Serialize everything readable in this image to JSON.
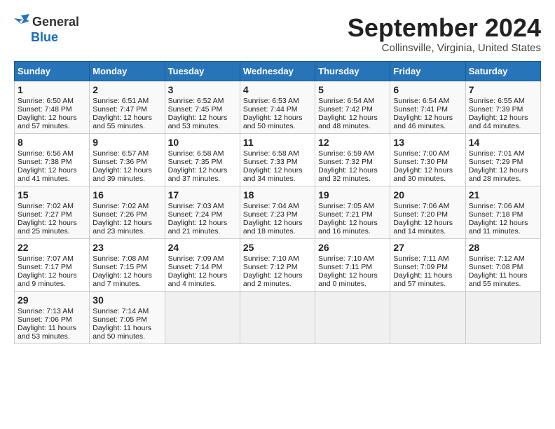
{
  "header": {
    "logo_line1": "General",
    "logo_line2": "Blue",
    "title": "September 2024",
    "subtitle": "Collinsville, Virginia, United States"
  },
  "columns": [
    "Sunday",
    "Monday",
    "Tuesday",
    "Wednesday",
    "Thursday",
    "Friday",
    "Saturday"
  ],
  "weeks": [
    [
      {
        "day": "1",
        "lines": [
          "Sunrise: 6:50 AM",
          "Sunset: 7:48 PM",
          "Daylight: 12 hours",
          "and 57 minutes."
        ]
      },
      {
        "day": "2",
        "lines": [
          "Sunrise: 6:51 AM",
          "Sunset: 7:47 PM",
          "Daylight: 12 hours",
          "and 55 minutes."
        ]
      },
      {
        "day": "3",
        "lines": [
          "Sunrise: 6:52 AM",
          "Sunset: 7:45 PM",
          "Daylight: 12 hours",
          "and 53 minutes."
        ]
      },
      {
        "day": "4",
        "lines": [
          "Sunrise: 6:53 AM",
          "Sunset: 7:44 PM",
          "Daylight: 12 hours",
          "and 50 minutes."
        ]
      },
      {
        "day": "5",
        "lines": [
          "Sunrise: 6:54 AM",
          "Sunset: 7:42 PM",
          "Daylight: 12 hours",
          "and 48 minutes."
        ]
      },
      {
        "day": "6",
        "lines": [
          "Sunrise: 6:54 AM",
          "Sunset: 7:41 PM",
          "Daylight: 12 hours",
          "and 46 minutes."
        ]
      },
      {
        "day": "7",
        "lines": [
          "Sunrise: 6:55 AM",
          "Sunset: 7:39 PM",
          "Daylight: 12 hours",
          "and 44 minutes."
        ]
      }
    ],
    [
      {
        "day": "8",
        "lines": [
          "Sunrise: 6:56 AM",
          "Sunset: 7:38 PM",
          "Daylight: 12 hours",
          "and 41 minutes."
        ]
      },
      {
        "day": "9",
        "lines": [
          "Sunrise: 6:57 AM",
          "Sunset: 7:36 PM",
          "Daylight: 12 hours",
          "and 39 minutes."
        ]
      },
      {
        "day": "10",
        "lines": [
          "Sunrise: 6:58 AM",
          "Sunset: 7:35 PM",
          "Daylight: 12 hours",
          "and 37 minutes."
        ]
      },
      {
        "day": "11",
        "lines": [
          "Sunrise: 6:58 AM",
          "Sunset: 7:33 PM",
          "Daylight: 12 hours",
          "and 34 minutes."
        ]
      },
      {
        "day": "12",
        "lines": [
          "Sunrise: 6:59 AM",
          "Sunset: 7:32 PM",
          "Daylight: 12 hours",
          "and 32 minutes."
        ]
      },
      {
        "day": "13",
        "lines": [
          "Sunrise: 7:00 AM",
          "Sunset: 7:30 PM",
          "Daylight: 12 hours",
          "and 30 minutes."
        ]
      },
      {
        "day": "14",
        "lines": [
          "Sunrise: 7:01 AM",
          "Sunset: 7:29 PM",
          "Daylight: 12 hours",
          "and 28 minutes."
        ]
      }
    ],
    [
      {
        "day": "15",
        "lines": [
          "Sunrise: 7:02 AM",
          "Sunset: 7:27 PM",
          "Daylight: 12 hours",
          "and 25 minutes."
        ]
      },
      {
        "day": "16",
        "lines": [
          "Sunrise: 7:02 AM",
          "Sunset: 7:26 PM",
          "Daylight: 12 hours",
          "and 23 minutes."
        ]
      },
      {
        "day": "17",
        "lines": [
          "Sunrise: 7:03 AM",
          "Sunset: 7:24 PM",
          "Daylight: 12 hours",
          "and 21 minutes."
        ]
      },
      {
        "day": "18",
        "lines": [
          "Sunrise: 7:04 AM",
          "Sunset: 7:23 PM",
          "Daylight: 12 hours",
          "and 18 minutes."
        ]
      },
      {
        "day": "19",
        "lines": [
          "Sunrise: 7:05 AM",
          "Sunset: 7:21 PM",
          "Daylight: 12 hours",
          "and 16 minutes."
        ]
      },
      {
        "day": "20",
        "lines": [
          "Sunrise: 7:06 AM",
          "Sunset: 7:20 PM",
          "Daylight: 12 hours",
          "and 14 minutes."
        ]
      },
      {
        "day": "21",
        "lines": [
          "Sunrise: 7:06 AM",
          "Sunset: 7:18 PM",
          "Daylight: 12 hours",
          "and 11 minutes."
        ]
      }
    ],
    [
      {
        "day": "22",
        "lines": [
          "Sunrise: 7:07 AM",
          "Sunset: 7:17 PM",
          "Daylight: 12 hours",
          "and 9 minutes."
        ]
      },
      {
        "day": "23",
        "lines": [
          "Sunrise: 7:08 AM",
          "Sunset: 7:15 PM",
          "Daylight: 12 hours",
          "and 7 minutes."
        ]
      },
      {
        "day": "24",
        "lines": [
          "Sunrise: 7:09 AM",
          "Sunset: 7:14 PM",
          "Daylight: 12 hours",
          "and 4 minutes."
        ]
      },
      {
        "day": "25",
        "lines": [
          "Sunrise: 7:10 AM",
          "Sunset: 7:12 PM",
          "Daylight: 12 hours",
          "and 2 minutes."
        ]
      },
      {
        "day": "26",
        "lines": [
          "Sunrise: 7:10 AM",
          "Sunset: 7:11 PM",
          "Daylight: 12 hours",
          "and 0 minutes."
        ]
      },
      {
        "day": "27",
        "lines": [
          "Sunrise: 7:11 AM",
          "Sunset: 7:09 PM",
          "Daylight: 11 hours",
          "and 57 minutes."
        ]
      },
      {
        "day": "28",
        "lines": [
          "Sunrise: 7:12 AM",
          "Sunset: 7:08 PM",
          "Daylight: 11 hours",
          "and 55 minutes."
        ]
      }
    ],
    [
      {
        "day": "29",
        "lines": [
          "Sunrise: 7:13 AM",
          "Sunset: 7:06 PM",
          "Daylight: 11 hours",
          "and 53 minutes."
        ]
      },
      {
        "day": "30",
        "lines": [
          "Sunrise: 7:14 AM",
          "Sunset: 7:05 PM",
          "Daylight: 11 hours",
          "and 50 minutes."
        ]
      },
      {
        "day": "",
        "lines": []
      },
      {
        "day": "",
        "lines": []
      },
      {
        "day": "",
        "lines": []
      },
      {
        "day": "",
        "lines": []
      },
      {
        "day": "",
        "lines": []
      }
    ]
  ]
}
